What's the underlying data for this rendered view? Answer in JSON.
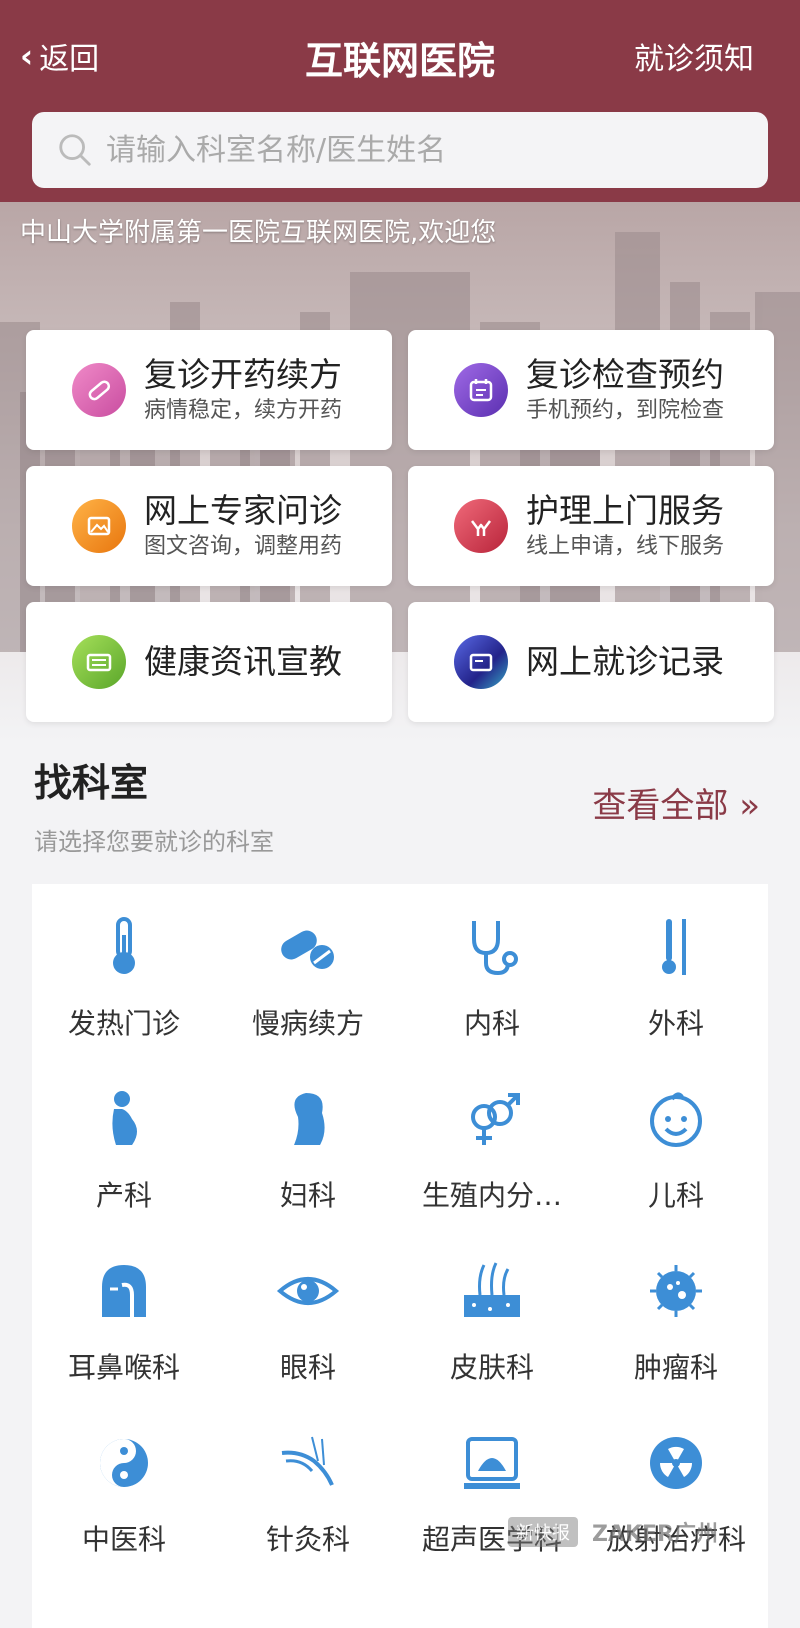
{
  "header": {
    "back_label": "返回",
    "title": "互联网医院",
    "notice_label": "就诊须知",
    "bg_color": "#8a3a47"
  },
  "search": {
    "placeholder": "请输入科室名称/医生姓名"
  },
  "banner": {
    "welcome": "中山大学附属第一医院互联网医院,欢迎您"
  },
  "services": [
    {
      "title": "复诊开药续方",
      "subtitle": "病情稳定，续方开药",
      "icon": "pill-icon",
      "color": "#d85aa8"
    },
    {
      "title": "复诊检查预约",
      "subtitle": "手机预约，到院检查",
      "icon": "calendar-icon",
      "color": "#7a3fc9"
    },
    {
      "title": "网上专家问诊",
      "subtitle": "图文咨询，调整用药",
      "icon": "image-chat-icon",
      "color": "#f08a1c"
    },
    {
      "title": "护理上门服务",
      "subtitle": "线上申请，线下服务",
      "icon": "nursing-hands-icon",
      "color": "#d8374a"
    },
    {
      "title": "健康资讯宣教",
      "subtitle": "",
      "icon": "news-icon",
      "color": "#7cc23a"
    },
    {
      "title": "网上就诊记录",
      "subtitle": "",
      "icon": "record-icon",
      "color": "#3a47c9"
    }
  ],
  "departments": {
    "title": "找科室",
    "subtitle": "请选择您要就诊的科室",
    "view_all": "查看全部 »",
    "icon_color": "#3d8ed6",
    "items": [
      {
        "label": "发热门诊",
        "icon": "thermometer-icon"
      },
      {
        "label": "慢病续方",
        "icon": "capsule-icon"
      },
      {
        "label": "内科",
        "icon": "stethoscope-icon"
      },
      {
        "label": "外科",
        "icon": "scalpel-icon"
      },
      {
        "label": "产科",
        "icon": "pregnant-icon"
      },
      {
        "label": "妇科",
        "icon": "woman-icon"
      },
      {
        "label": "生殖内分…",
        "icon": "gender-icon"
      },
      {
        "label": "儿科",
        "icon": "baby-face-icon"
      },
      {
        "label": "耳鼻喉科",
        "icon": "ent-head-icon"
      },
      {
        "label": "眼科",
        "icon": "eye-icon"
      },
      {
        "label": "皮肤科",
        "icon": "skin-hair-icon"
      },
      {
        "label": "肿瘤科",
        "icon": "tumor-cell-icon"
      },
      {
        "label": "中医科",
        "icon": "yin-yang-icon"
      },
      {
        "label": "针灸科",
        "icon": "acupuncture-hand-icon"
      },
      {
        "label": "超声医学科",
        "icon": "ultrasound-icon"
      },
      {
        "label": "放射治疗科",
        "icon": "radiation-icon"
      }
    ]
  },
  "watermark": {
    "source1": "新快报",
    "source2": "ZAKER广州"
  }
}
